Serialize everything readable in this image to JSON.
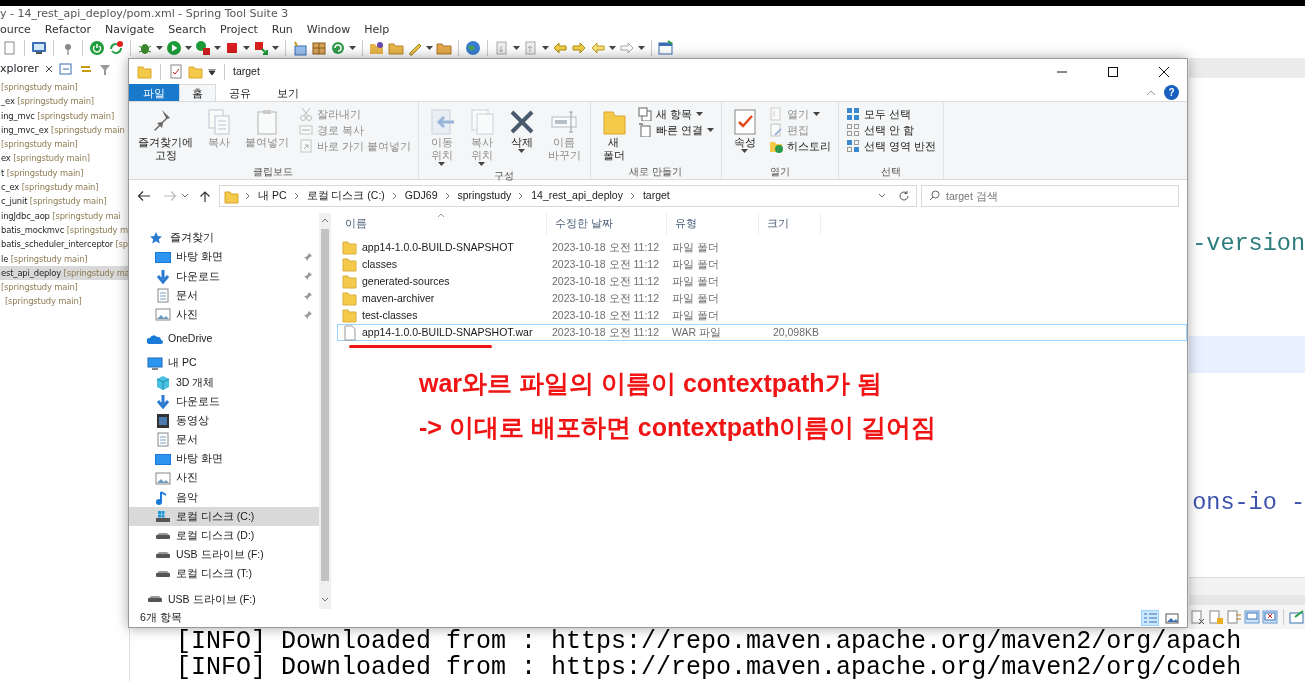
{
  "ide": {
    "title": "y - 14_rest_api_deploy/pom.xml - Spring Tool Suite 3",
    "menu": [
      "ource",
      "Refactor",
      "Navigate",
      "Search",
      "Project",
      "Run",
      "Window",
      "Help"
    ],
    "project_explorer": {
      "tab": "xplorer",
      "projects": [
        {
          "repo": "[springstudy main]",
          "selected": false
        },
        {
          "name": "_ex",
          "repo": "[springstudy main]",
          "selected": false
        },
        {
          "name": "ing_mvc",
          "repo": "[springstudy main]",
          "selected": false
        },
        {
          "name": "ing_mvc_ex",
          "repo": "[springstudy main",
          "selected": false
        },
        {
          "repo": "[springstudy main]",
          "selected": false
        },
        {
          "name": "ex",
          "repo": "[springstudy main]",
          "selected": false
        },
        {
          "name": "t",
          "repo": "[springstudy main]",
          "selected": false
        },
        {
          "name": "c_ex",
          "repo": "[springstudy main]",
          "selected": false
        },
        {
          "name": "c_junit",
          "repo": "[springstudy main]",
          "selected": false
        },
        {
          "name": "ingJdbc_aop",
          "repo": "[springstudy mai",
          "selected": false
        },
        {
          "name": "batis_mockmvc",
          "repo": "[springstudy m",
          "selected": false
        },
        {
          "name": "batis_scheduler_interceptor",
          "repo": "[sp",
          "selected": false
        },
        {
          "name": "le",
          "repo": "[springstudy main]",
          "selected": false
        },
        {
          "name": "est_api_deploy",
          "repo": "[springstudy ma",
          "selected": true
        },
        {
          "repo": "[springstudy main]",
          "selected": false
        },
        {
          "repo": "[springstudy main]",
          "selected": false
        }
      ]
    },
    "editor_lines": [
      {
        "kind": "attribute",
        "text": "-version"
      },
      {
        "kind": "blank"
      },
      {
        "kind": "blank"
      },
      {
        "kind": "current"
      },
      {
        "kind": "blank"
      },
      {
        "kind": "blank"
      },
      {
        "kind": "blank"
      },
      {
        "kind": "text",
        "text": "ons-io -"
      }
    ],
    "console_lines": [
      "[INFO] Downloaded from : https://repo.maven.apache.org/maven2/org/apach",
      "[INFO] Downloaded from : https://repo.maven.apache.org/maven2/org/codeh"
    ]
  },
  "explorer": {
    "title": "target",
    "tabs": [
      {
        "label": "파일",
        "kind": "file",
        "selected": false
      },
      {
        "label": "홈",
        "kind": "tab",
        "selected": true
      },
      {
        "label": "공유",
        "kind": "tab",
        "selected": false
      },
      {
        "label": "보기",
        "kind": "tab",
        "selected": false
      }
    ],
    "ribbon_groups": [
      {
        "label": "클립보드",
        "items": [
          {
            "label": "즐겨찾기에\n고정",
            "kind": "large",
            "disabled": false,
            "menu": false
          },
          {
            "label": "복사",
            "kind": "large",
            "disabled": true,
            "menu": false
          },
          {
            "label": "붙여넣기",
            "kind": "large",
            "disabled": true,
            "menu": false
          },
          {
            "label": "잘라내기",
            "kind": "small",
            "disabled": true,
            "menu": false
          },
          {
            "label": "경로 복사",
            "kind": "small",
            "disabled": true,
            "menu": false
          },
          {
            "label": "바로 가기 붙여넣기",
            "kind": "small",
            "disabled": true,
            "menu": false
          }
        ]
      },
      {
        "label": "구성",
        "items": [
          {
            "label": "이동\n위치",
            "kind": "large",
            "disabled": true,
            "menu": true
          },
          {
            "label": "복사\n위치",
            "kind": "large",
            "disabled": true,
            "menu": true
          },
          {
            "label": "삭제",
            "kind": "large",
            "disabled": false,
            "menu": true
          },
          {
            "label": "이름\n바꾸기",
            "kind": "large",
            "disabled": true,
            "menu": false
          }
        ]
      },
      {
        "label": "새로 만들기",
        "items": [
          {
            "label": "새\n폴더",
            "kind": "large",
            "disabled": false,
            "menu": false
          },
          {
            "label": "새 항목",
            "kind": "small",
            "disabled": false,
            "menu": true
          },
          {
            "label": "빠른 연결",
            "kind": "small",
            "disabled": false,
            "menu": true
          }
        ]
      },
      {
        "label": "열기",
        "items": [
          {
            "label": "속성",
            "kind": "large",
            "disabled": false,
            "menu": true
          },
          {
            "label": "열기",
            "kind": "small",
            "disabled": true,
            "menu": true
          },
          {
            "label": "편집",
            "kind": "small",
            "disabled": true,
            "menu": false
          },
          {
            "label": "히스토리",
            "kind": "small",
            "disabled": false,
            "menu": false
          }
        ]
      },
      {
        "label": "선택",
        "items": [
          {
            "label": "모두 선택",
            "kind": "small",
            "disabled": false,
            "menu": false
          },
          {
            "label": "선택 안 함",
            "kind": "small",
            "disabled": false,
            "menu": false
          },
          {
            "label": "선택 영역 반전",
            "kind": "small",
            "disabled": false,
            "menu": false
          }
        ]
      }
    ],
    "help": "?",
    "breadcrumbs": [
      "내 PC",
      "로컬 디스크 (C:)",
      "GDJ69",
      "springstudy",
      "14_rest_api_deploy",
      "target"
    ],
    "search": {
      "placeholder": "target 검색"
    },
    "nav": [
      {
        "label": "즐겨찾기",
        "kind": "favorites",
        "selected": false,
        "children": [
          {
            "label": "바탕 화면",
            "kind": "desktop",
            "pinned": true,
            "selected": false
          },
          {
            "label": "다운로드",
            "kind": "downloads",
            "pinned": true,
            "selected": false
          },
          {
            "label": "문서",
            "kind": "documents",
            "pinned": true,
            "selected": false
          },
          {
            "label": "사진",
            "kind": "pictures",
            "pinned": true,
            "selected": false
          }
        ]
      },
      {
        "label": "OneDrive",
        "kind": "onedrive",
        "selected": false
      },
      {
        "label": "내 PC",
        "kind": "pc",
        "selected": false,
        "children": [
          {
            "label": "3D 개체",
            "kind": "objects3d",
            "pinned": false,
            "selected": false
          },
          {
            "label": "다운로드",
            "kind": "downloads",
            "pinned": false,
            "selected": false
          },
          {
            "label": "동영상",
            "kind": "videos",
            "pinned": false,
            "selected": false
          },
          {
            "label": "문서",
            "kind": "documents",
            "pinned": false,
            "selected": false
          },
          {
            "label": "바탕 화면",
            "kind": "desktop",
            "pinned": false,
            "selected": false
          },
          {
            "label": "사진",
            "kind": "pictures",
            "pinned": false,
            "selected": false
          },
          {
            "label": "음악",
            "kind": "music",
            "pinned": false,
            "selected": false
          },
          {
            "label": "로컬 디스크 (C:)",
            "kind": "system-drive",
            "pinned": false,
            "selected": true
          },
          {
            "label": "로컬 디스크 (D:)",
            "kind": "drive",
            "pinned": false,
            "selected": false
          },
          {
            "label": "USB 드라이브 (F:)",
            "kind": "drive",
            "pinned": false,
            "selected": false
          },
          {
            "label": "로컬 디스크 (T:)",
            "kind": "drive",
            "pinned": false,
            "selected": false
          }
        ]
      },
      {
        "label": "USB 드라이브 (F:)",
        "kind": "drive",
        "selected": false
      }
    ],
    "columns": [
      {
        "label": "이름",
        "sorted": true
      },
      {
        "label": "수정한 날짜",
        "sorted": false
      },
      {
        "label": "유형",
        "sorted": false
      },
      {
        "label": "크기",
        "sorted": false
      }
    ],
    "files": [
      {
        "name": "app14-1.0.0-BUILD-SNAPSHOT",
        "date": "2023-10-18 오전 11:12",
        "type": "파일 폴더",
        "kind": "folder",
        "focused": false,
        "underlined": false
      },
      {
        "name": "classes",
        "date": "2023-10-18 오전 11:12",
        "type": "파일 폴더",
        "kind": "folder",
        "focused": false,
        "underlined": false
      },
      {
        "name": "generated-sources",
        "date": "2023-10-18 오전 11:12",
        "type": "파일 폴더",
        "kind": "folder",
        "focused": false,
        "underlined": false
      },
      {
        "name": "maven-archiver",
        "date": "2023-10-18 오전 11:12",
        "type": "파일 폴더",
        "kind": "folder",
        "focused": false,
        "underlined": false
      },
      {
        "name": "test-classes",
        "date": "2023-10-18 오전 11:12",
        "type": "파일 폴더",
        "kind": "folder",
        "focused": false,
        "underlined": false
      },
      {
        "name": "app14-1.0.0-BUILD-SNAPSHOT.war",
        "date": "2023-10-18 오전 11:12",
        "type": "WAR 파일",
        "size": "20,098KB",
        "kind": "file",
        "focused": true,
        "underlined": true
      }
    ],
    "annotation": [
      "war와르 파일의 이름이 contextpath가 됨",
      "-> 이대로 배포하면 contextpath이름이 길어짐"
    ],
    "status": "6개 항목",
    "view_buttons": [
      {
        "kind": "details",
        "selected": true
      },
      {
        "kind": "large-icons",
        "selected": false
      }
    ]
  }
}
